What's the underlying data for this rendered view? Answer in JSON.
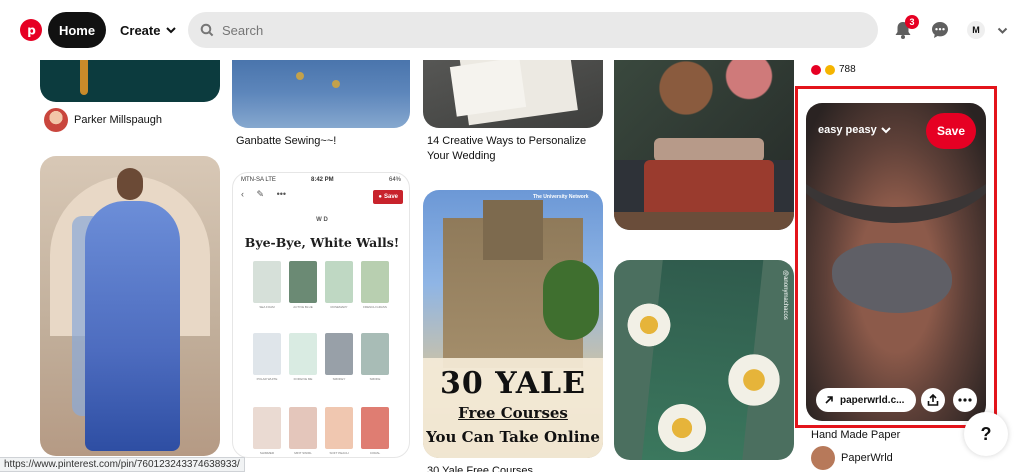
{
  "header": {
    "home_label": "Home",
    "create_label": "Create",
    "search_placeholder": "Search",
    "notifications_count": "3",
    "account_initial": "M",
    "brand_color": "#e60023"
  },
  "pins": {
    "col1": {
      "author_name": "Parker Millspaugh"
    },
    "col2": {
      "caption": "Ganbatte Sewing~~!",
      "status_left": "MTN-SA LTE",
      "status_time": "8:42 PM",
      "status_right": "64%",
      "save_label": "Save",
      "logo_text": "W D",
      "title": "Bye-Bye, White Walls!",
      "swatch_labels": [
        "SEA FOAM",
        "ACTIVE BLUE",
        "ROSEMARY",
        "FRENCH GRASS",
        "POLAR WHITE",
        "FORGIVE ME",
        "SMOKEY",
        "SMOKE",
        "SHIMMER",
        "MINT SWIRL",
        "SOFT PEACH",
        "CORAL"
      ]
    },
    "col3": {
      "caption_line1": "14 Creative Ways to Personalize",
      "caption_line2": "Your Wedding",
      "yale_brand": "The University Network",
      "yale_big": "30 YALE",
      "yale_free": "Free Courses",
      "yale_online": "You Can Take Online",
      "caption2": "30 Yale Free Courses"
    },
    "col4": {
      "watermark": "@anonymachacos"
    },
    "col5": {
      "reactions_count": "788",
      "board_label": "easy peasy",
      "save_label": "Save",
      "link_label": "paperwrld.c...",
      "caption": "Hand Made Paper",
      "author_name": "PaperWrld"
    }
  },
  "status_url": "https://www.pinterest.com/pin/760123243374638933/"
}
